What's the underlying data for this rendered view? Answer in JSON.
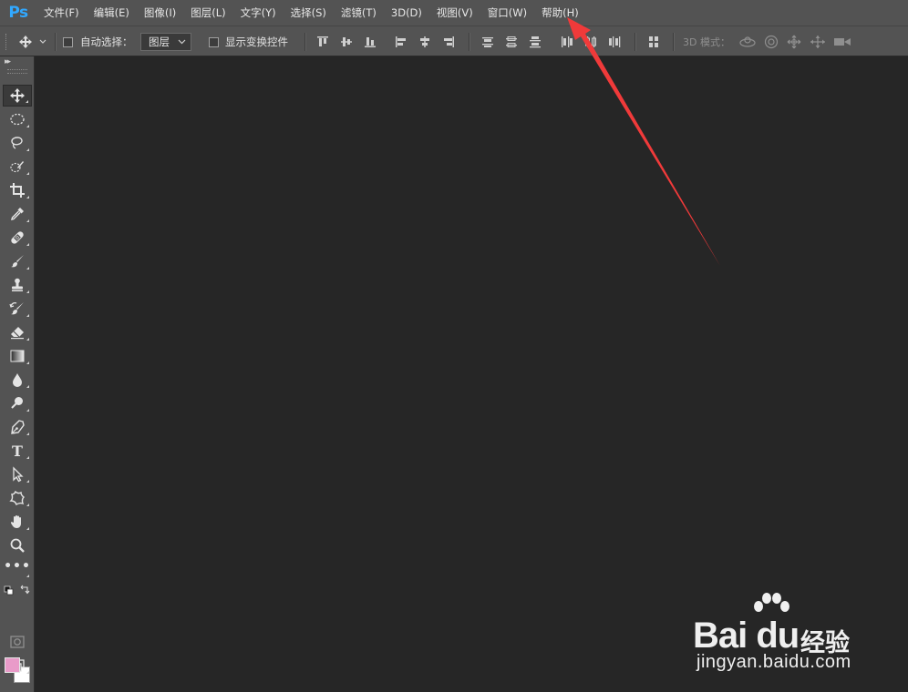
{
  "app": {
    "logo_text": "Ps"
  },
  "menu": [
    {
      "label": "文件(F)"
    },
    {
      "label": "编辑(E)"
    },
    {
      "label": "图像(I)"
    },
    {
      "label": "图层(L)"
    },
    {
      "label": "文字(Y)"
    },
    {
      "label": "选择(S)"
    },
    {
      "label": "滤镜(T)"
    },
    {
      "label": "3D(D)"
    },
    {
      "label": "视图(V)"
    },
    {
      "label": "窗口(W)"
    },
    {
      "label": "帮助(H)"
    }
  ],
  "options": {
    "auto_select_label": "自动选择：",
    "auto_select_checked": false,
    "auto_select_target": "图层",
    "show_transform_label": "显示变换控件",
    "show_transform_checked": false,
    "mode_3d_label": "3D 模式："
  },
  "colors": {
    "foreground": "#e99bc9",
    "background": "#ffffff",
    "annotation_arrow": "#f03a3a"
  },
  "tools": [
    {
      "name": "move-tool",
      "icon": "move-icon",
      "active": true
    },
    {
      "name": "elliptical-marquee-tool",
      "icon": "ellipse-marquee-icon"
    },
    {
      "name": "lasso-tool",
      "icon": "lasso-icon"
    },
    {
      "name": "quick-selection-tool",
      "icon": "quick-selection-icon"
    },
    {
      "name": "crop-tool",
      "icon": "crop-icon"
    },
    {
      "name": "eyedropper-tool",
      "icon": "eyedropper-icon"
    },
    {
      "name": "healing-brush-tool",
      "icon": "bandage-icon"
    },
    {
      "name": "brush-tool",
      "icon": "brush-icon"
    },
    {
      "name": "clone-stamp-tool",
      "icon": "stamp-icon"
    },
    {
      "name": "history-brush-tool",
      "icon": "history-brush-icon"
    },
    {
      "name": "eraser-tool",
      "icon": "eraser-icon"
    },
    {
      "name": "gradient-tool",
      "icon": "gradient-icon"
    },
    {
      "name": "blur-tool",
      "icon": "droplet-icon"
    },
    {
      "name": "dodge-tool",
      "icon": "dodge-icon"
    },
    {
      "name": "pen-tool",
      "icon": "pen-icon"
    },
    {
      "name": "type-tool",
      "icon": "type-icon"
    },
    {
      "name": "path-selection-tool",
      "icon": "cursor-arrow-icon"
    },
    {
      "name": "custom-shape-tool",
      "icon": "shape-icon"
    },
    {
      "name": "hand-tool",
      "icon": "hand-icon"
    },
    {
      "name": "zoom-tool",
      "icon": "magnifier-icon"
    },
    {
      "name": "edit-toolbar-button",
      "icon": "more-icon"
    }
  ],
  "watermark": {
    "brand": "Bai du",
    "cn_text": "经验",
    "url": "jingyan.baidu.com"
  }
}
